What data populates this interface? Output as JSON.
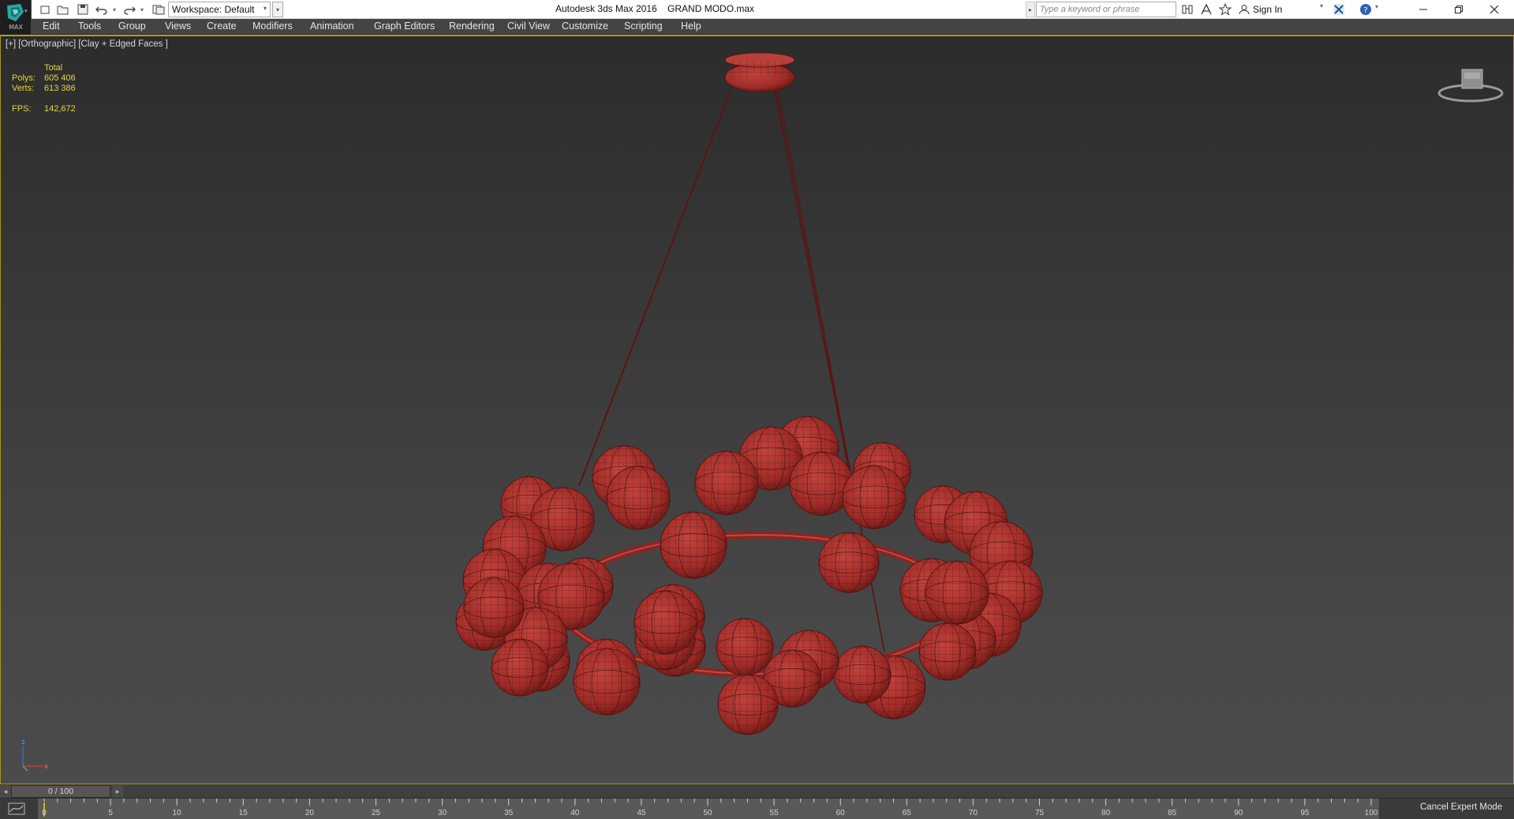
{
  "app_logo_text": "MAX",
  "workspace": {
    "label": "Workspace: Default"
  },
  "title": {
    "app": "Autodesk 3ds Max 2016",
    "file": "GRAND MODO.max"
  },
  "search": {
    "placeholder": "Type a keyword or phrase"
  },
  "account": {
    "sign_in": "Sign In"
  },
  "menu": [
    "Edit",
    "Tools",
    "Group",
    "Views",
    "Create",
    "Modifiers",
    "Animation",
    "Graph Editors",
    "Rendering",
    "Civil View",
    "Customize",
    "Scripting",
    "Help"
  ],
  "viewport": {
    "label": "[+] [Orthographic] [Clay + Edged Faces ]",
    "stats": {
      "header": "Total",
      "polys_label": "Polys:",
      "polys_value": "605 406",
      "verts_label": "Verts:",
      "verts_value": "613 386",
      "fps_label": "FPS:",
      "fps_value": "142,672"
    },
    "axis_labels": {
      "z": "z",
      "x": "x"
    },
    "model_color": "#b0332f"
  },
  "time_slider": {
    "frame": "0 / 100",
    "start": 0,
    "end": 100
  },
  "track_bar": {
    "tick_labels": [
      "0",
      "5",
      "10",
      "15",
      "20",
      "25",
      "30",
      "35",
      "40",
      "45",
      "50",
      "55",
      "60",
      "65",
      "70",
      "75",
      "80",
      "85",
      "90",
      "95",
      "100"
    ]
  },
  "status": {
    "cancel_expert": "Cancel Expert Mode"
  },
  "colors": {
    "accent": "#b89b1a",
    "menubar": "#444444",
    "stats_text": "#e4d63a"
  }
}
